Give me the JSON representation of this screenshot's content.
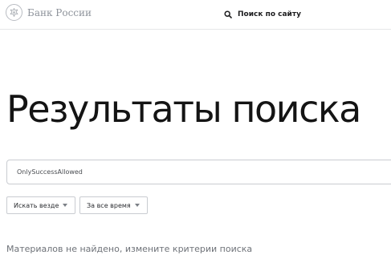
{
  "header": {
    "logo_text": "Банк России",
    "logo_icon": "eagle-emblem-icon",
    "search_label": "Поиск по сайту",
    "search_icon": "search-icon"
  },
  "main": {
    "title": "Результаты поиска",
    "search_query": "OnlySuccessAllowed",
    "filters": {
      "where": "Искать везде",
      "time": "За все время"
    },
    "empty_message": "Материалов не найдено, измените критерии поиска"
  },
  "colors": {
    "text_primary": "#141414",
    "text_muted": "#8e939b",
    "border": "#c9ccd1",
    "background": "#ffffff"
  }
}
